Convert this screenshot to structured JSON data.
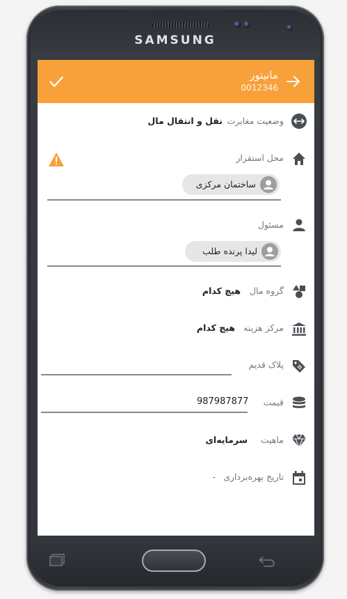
{
  "device": {
    "brand": "SAMSUNG"
  },
  "appbar": {
    "title": "مانیتور",
    "subtitle": "0012346",
    "confirm_icon": "check-icon",
    "back_icon": "arrow-forward-icon",
    "color": "#f8a03a"
  },
  "form": {
    "status": {
      "label": "وضعیت مغایرت",
      "value": "نقل و انتقال مال",
      "icon": "transfer-icon"
    },
    "location": {
      "label": "محل استقرار",
      "chip": "ساختمان مرکزی",
      "icon": "home-icon",
      "warning_icon": "warning-icon"
    },
    "responsible": {
      "label": "مسئول",
      "chip": "لیدا پرنده طلب",
      "icon": "person-icon"
    },
    "asset_group": {
      "label": "گروه مال",
      "value": "هیچ کدام",
      "icon": "shapes-icon"
    },
    "cost_center": {
      "label": "مرکز هزینه",
      "value": "هیچ کدام",
      "icon": "bank-icon"
    },
    "old_tag": {
      "label": "پلاک قدیم",
      "value": "",
      "icon": "tag-icon"
    },
    "price": {
      "label": "قیمت",
      "value": "987987877",
      "icon": "coins-icon"
    },
    "nature": {
      "label": "ماهیت",
      "value": "سرمایه‌ای",
      "icon": "diamond-icon"
    },
    "usage_date": {
      "label": "تاریخ بهره‌برداری",
      "value": "-",
      "icon": "calendar-icon"
    }
  }
}
